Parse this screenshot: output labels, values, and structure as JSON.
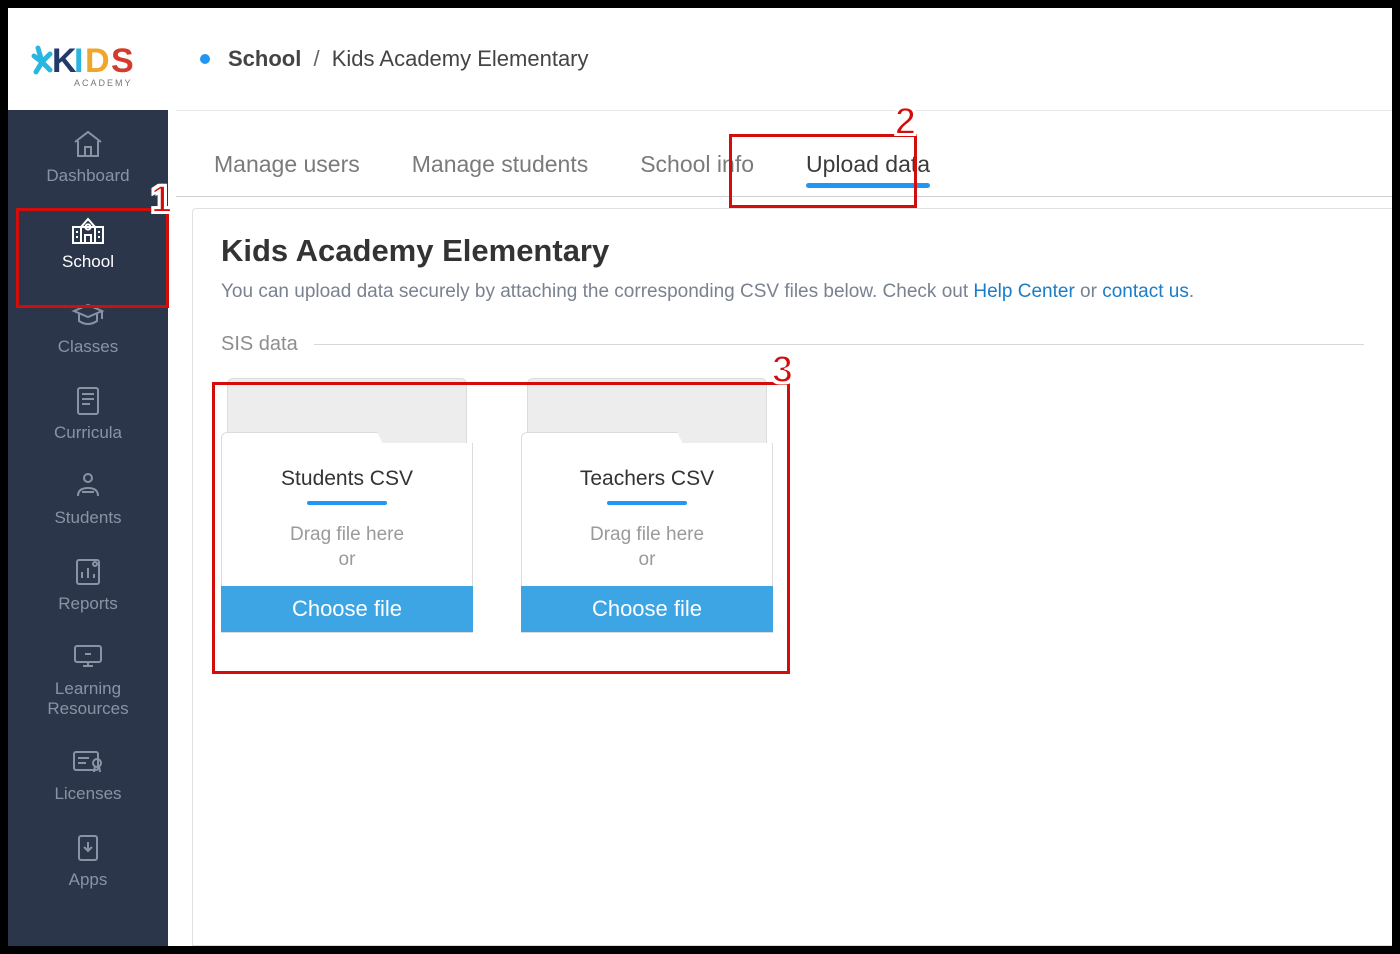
{
  "breadcrumb": {
    "root": "School",
    "current": "Kids Academy Elementary"
  },
  "sidebar": {
    "items": [
      {
        "label": "Dashboard"
      },
      {
        "label": "School"
      },
      {
        "label": "Classes"
      },
      {
        "label": "Curricula"
      },
      {
        "label": "Students"
      },
      {
        "label": "Reports"
      },
      {
        "label": "Learning Resources"
      },
      {
        "label": "Licenses"
      },
      {
        "label": "Apps"
      }
    ]
  },
  "tabs": {
    "items": [
      {
        "label": "Manage users"
      },
      {
        "label": "Manage students"
      },
      {
        "label": "School info"
      },
      {
        "label": "Upload data"
      }
    ]
  },
  "page": {
    "title": "Kids Academy Elementary",
    "desc_prefix": "You can upload data securely by attaching the corresponding CSV files below.  Check out ",
    "link_help_center": "Help Center",
    "desc_middle": " or ",
    "link_contact": "contact us",
    "desc_suffix": ".",
    "section_title": "SIS data"
  },
  "cards": [
    {
      "title": "Students CSV",
      "drag_line1": "Drag file here",
      "drag_line2": "or",
      "button": "Choose file"
    },
    {
      "title": "Teachers CSV",
      "drag_line1": "Drag file here",
      "drag_line2": "or",
      "button": "Choose file"
    }
  ],
  "callouts": {
    "n1": "1",
    "n2": "2",
    "n3": "3"
  }
}
